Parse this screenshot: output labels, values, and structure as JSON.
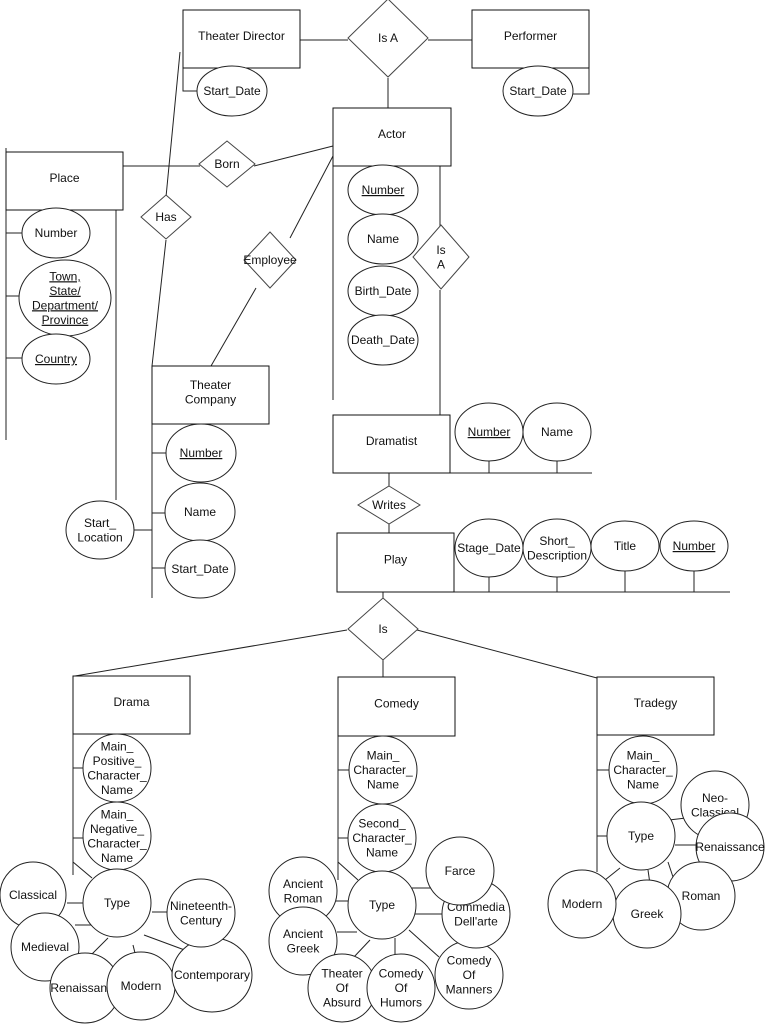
{
  "diagram": {
    "type": "entity-relationship",
    "entities": {
      "theater_director": "Theater Director",
      "performer": "Performer",
      "actor": "Actor",
      "place": "Place",
      "theater_company": [
        "Theater",
        "Company"
      ],
      "dramatist": "Dramatist",
      "play": "Play",
      "drama": "Drama",
      "comedy": "Comedy",
      "tragedy": "Tradegy"
    },
    "relationships": {
      "is_a_top": "Is A",
      "born": "Born",
      "has": "Has",
      "employee": "Employee",
      "is_a_actor": [
        "Is",
        "A"
      ],
      "writes": "Writes",
      "is_play": "Is"
    },
    "attributes": {
      "theater_director": [
        {
          "label": [
            "Start_Date"
          ],
          "key": false
        }
      ],
      "performer": [
        {
          "label": [
            "Start_Date"
          ],
          "key": false
        }
      ],
      "actor": [
        {
          "label": [
            "Number"
          ],
          "key": true
        },
        {
          "label": [
            "Name"
          ],
          "key": false
        },
        {
          "label": [
            "Birth_Date"
          ],
          "key": false
        },
        {
          "label": [
            "Death_Date"
          ],
          "key": false
        }
      ],
      "place": [
        {
          "label": [
            "Number"
          ],
          "key": false
        },
        {
          "label": [
            "Town,",
            "State/",
            "Department/",
            "Province"
          ],
          "key": true
        },
        {
          "label": [
            "Country"
          ],
          "key": true
        }
      ],
      "theater_company": [
        {
          "label": [
            "Number"
          ],
          "key": true
        },
        {
          "label": [
            "Name"
          ],
          "key": false
        },
        {
          "label": [
            "Start_Date"
          ],
          "key": false
        }
      ],
      "has_relationship": [
        {
          "label": [
            "Start_",
            "Location"
          ],
          "key": false
        }
      ],
      "dramatist": [
        {
          "label": [
            "Number"
          ],
          "key": true
        },
        {
          "label": [
            "Name"
          ],
          "key": false
        }
      ],
      "play": [
        {
          "label": [
            "Stage_Date"
          ],
          "key": false
        },
        {
          "label": [
            "Short_",
            "Description"
          ],
          "key": false
        },
        {
          "label": [
            "Title"
          ],
          "key": false
        },
        {
          "label": [
            "Number"
          ],
          "key": true
        }
      ],
      "drama": [
        {
          "label": [
            "Main_",
            "Positive_",
            "Character_",
            "Name"
          ],
          "key": false
        },
        {
          "label": [
            "Main_",
            "Negative_",
            "Character_",
            "Name"
          ],
          "key": false
        },
        {
          "label": [
            "Type"
          ],
          "key": false
        }
      ],
      "drama_types": [
        "Classical",
        "Medieval",
        "Renaissance",
        "Modern",
        "Contemporary",
        [
          "Nineteenth-",
          "Century"
        ]
      ],
      "comedy": [
        {
          "label": [
            "Main_",
            "Character_",
            "Name"
          ],
          "key": false
        },
        {
          "label": [
            "Second_",
            "Character_",
            "Name"
          ],
          "key": false
        },
        {
          "label": [
            "Type"
          ],
          "key": false
        }
      ],
      "comedy_types": [
        [
          "Ancient",
          "Roman"
        ],
        [
          "Ancient",
          "Greek"
        ],
        [
          "Theater",
          "Of",
          "Absurd"
        ],
        [
          "Comedy",
          "Of",
          "Humors"
        ],
        [
          "Comedy",
          "Of",
          "Manners"
        ],
        [
          "Commedia",
          "Dell'arte"
        ],
        [
          "Farce"
        ]
      ],
      "tragedy": [
        {
          "label": [
            "Main_",
            "Character_",
            "Name"
          ],
          "key": false
        },
        {
          "label": [
            "Type"
          ],
          "key": false
        }
      ],
      "tragedy_types": [
        [
          "Neo-",
          "Classical"
        ],
        [
          "Renaissance"
        ],
        [
          "Roman"
        ],
        [
          "Greek"
        ],
        [
          "Modern"
        ]
      ]
    }
  }
}
